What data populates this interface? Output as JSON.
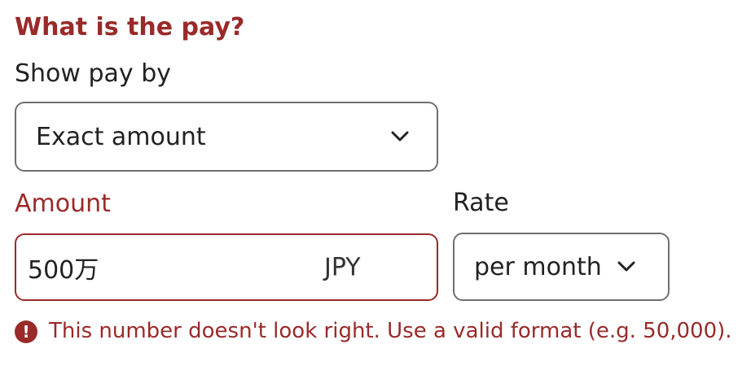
{
  "section": {
    "title": "What is the pay?"
  },
  "show_pay_by": {
    "label": "Show pay by",
    "selected": "Exact amount",
    "icon": "chevron-down-icon"
  },
  "amount": {
    "label": "Amount",
    "value": "500万",
    "currency": "JPY"
  },
  "rate": {
    "label": "Rate",
    "selected": "per month",
    "icon": "chevron-down-icon"
  },
  "error": {
    "icon": "exclamation-circle-icon",
    "icon_glyph": "!",
    "message": "This number doesn't look right. Use a valid format (e.g. 50,000)."
  },
  "colors": {
    "error": "#9a2a2a",
    "text": "#222222",
    "border": "#6f6f6f"
  }
}
